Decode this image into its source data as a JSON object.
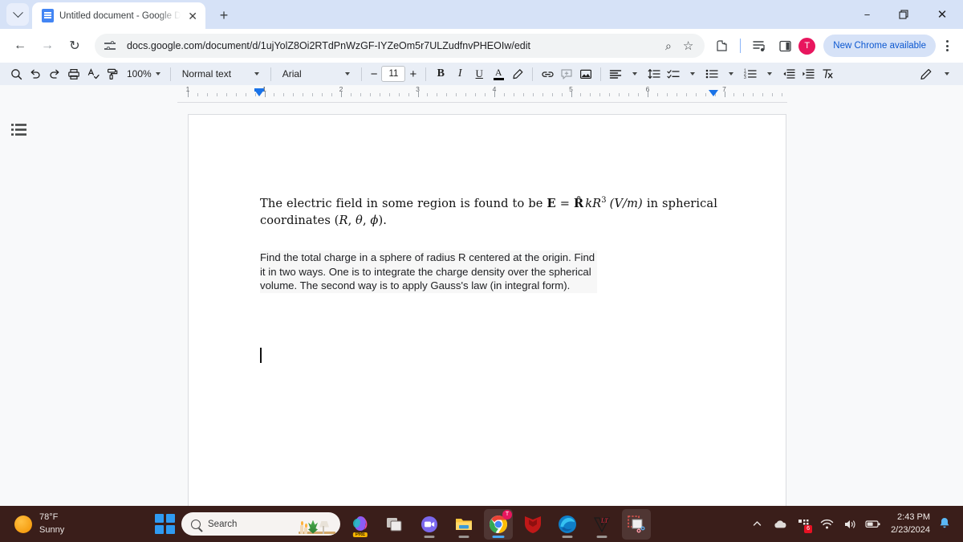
{
  "browser": {
    "tab": {
      "title": "Untitled document - Google Docs",
      "favicon": "google-docs-icon",
      "close_label": "✕"
    },
    "new_tab_label": "+",
    "tab_search_label": "tab-search",
    "window_controls": {
      "minimize": "−",
      "restore": "❐",
      "close": "✕"
    },
    "nav": {
      "back": "←",
      "forward": "→",
      "reload": "↻"
    },
    "omnibox": {
      "url": "docs.google.com/document/d/1ujYolZ8Oi2RTdPnWzGF-IYZeOm5r7ULZudfnvPHEOIw/edit",
      "site_info_icon": "tune-icon"
    },
    "omni_actions": {
      "zoom_search": "⌕",
      "bookmark": "☆",
      "extensions": "extensions-icon",
      "reading_list": "reading-list-icon",
      "side_panel": "side-panel-icon",
      "profile_initial": "T",
      "update_pill": "New Chrome available",
      "menu": "kebab-menu"
    }
  },
  "docs_toolbar": {
    "search": "search-icon",
    "undo": "undo-icon",
    "redo": "redo-icon",
    "print": "print-icon",
    "spellcheck": "spellcheck-icon",
    "paint_format": "paint-format-icon",
    "zoom_value": "100%",
    "paragraph_style": "Normal text",
    "font_family": "Arial",
    "font_size_decrease": "−",
    "font_size": "11",
    "font_size_increase": "+",
    "bold": "B",
    "italic": "I",
    "underline": "U",
    "text_color": "A",
    "highlight": "highlight-pen-icon",
    "insert_link": "link-icon",
    "add_comment": "comment-icon",
    "insert_image": "image-icon",
    "align": "align-left-icon",
    "line_spacing": "line-spacing-icon",
    "checklist": "checklist-icon",
    "bulleted_list": "bulleted-list-icon",
    "numbered_list": "numbered-list-icon",
    "decrease_indent": "decrease-indent-icon",
    "increase_indent": "increase-indent-icon",
    "clear_formatting": "clear-formatting-icon",
    "edit_mode": "edit-pencil-icon"
  },
  "ruler": {
    "numbers": [
      "1",
      "1",
      "2",
      "3",
      "4",
      "5",
      "6",
      "7"
    ],
    "left_indent_marker": "left-indent-marker",
    "right_indent_marker": "right-indent-marker"
  },
  "document": {
    "outline_button": "show-outline-icon",
    "paragraph_math": {
      "pre": "The electric field in some region is found to be ",
      "E": "E",
      "eq": " = ",
      "Rhat": "R̂",
      "k": "k",
      "R": "R",
      "exp": "3",
      "units": "(V/m)",
      "post": " in spherical coordinates ",
      "coords_open": "(",
      "coord_R": "R",
      "comma1": ", ",
      "coord_theta": "θ",
      "comma2": ", ",
      "coord_phi": "ϕ",
      "coords_close": ").",
      "full_text": "The electric field in some region is found to be E = R̂ kR³ (V/m) in spherical coordinates (R, θ, ϕ)."
    },
    "paragraph_plain": "Find the total charge in a sphere of radius R centered at the origin. Find it in two ways. One is to integrate the charge density over the spherical volume. The second way is to apply Gauss's law (in integral form)."
  },
  "taskbar": {
    "weather": {
      "temperature": "78°F",
      "condition": "Sunny",
      "icon": "sun-icon"
    },
    "start_button": "windows-start-icon",
    "search": {
      "placeholder": "Search",
      "icon": "search-icon",
      "decoration": "shelf-illustration"
    },
    "apps": [
      {
        "name": "copilot-icon",
        "badge": "PRE"
      },
      {
        "name": "task-view-icon",
        "badge": ""
      },
      {
        "name": "zoom-icon",
        "badge": ""
      },
      {
        "name": "file-explorer-icon",
        "badge": ""
      },
      {
        "name": "chrome-icon",
        "badge": "T"
      },
      {
        "name": "mcafee-icon",
        "badge": ""
      },
      {
        "name": "microsoft-edge-icon",
        "badge": ""
      },
      {
        "name": "latex-editor-icon",
        "badge": ""
      },
      {
        "name": "snipping-tool-icon",
        "badge": ""
      }
    ],
    "tray": {
      "show_hidden": "˄",
      "onedrive": "onedrive-cloud-icon",
      "devices_badge": "6",
      "wifi": "wifi-icon",
      "volume": "volume-icon",
      "battery": "battery-icon",
      "time": "2:43 PM",
      "date": "2/23/2024",
      "notifications": "notification-bell-icon"
    }
  },
  "colors": {
    "chrome_tabstrip": "#d6e2f7",
    "docs_toolbar": "#e9eef6",
    "docs_canvas": "#f8f9fa",
    "accent_blue": "#1a73e8",
    "taskbar": "#3a1e1a",
    "avatar_pink": "#e8165e"
  }
}
